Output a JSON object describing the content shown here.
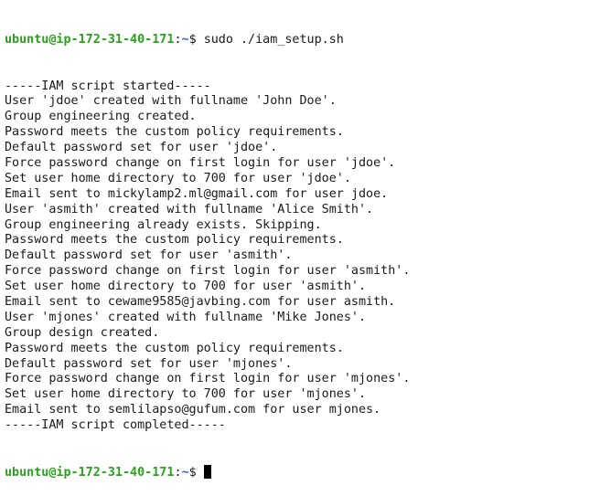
{
  "prompt": {
    "user_host": "ubuntu@ip-172-31-40-171",
    "separator": ":",
    "path": "~",
    "symbol": "$ "
  },
  "command": "sudo ./iam_setup.sh",
  "output_lines": [
    "-----IAM script started-----",
    "User 'jdoe' created with fullname 'John Doe'.",
    "Group engineering created.",
    "Password meets the custom policy requirements.",
    "Default password set for user 'jdoe'.",
    "Force password change on first login for user 'jdoe'.",
    "Set user home directory to 700 for user 'jdoe'.",
    "Email sent to mickylamp2.ml@gmail.com for user jdoe.",
    "User 'asmith' created with fullname 'Alice Smith'.",
    "Group engineering already exists. Skipping.",
    "Password meets the custom policy requirements.",
    "Default password set for user 'asmith'.",
    "Force password change on first login for user 'asmith'.",
    "Set user home directory to 700 for user 'asmith'.",
    "Email sent to cewame9585@javbing.com for user asmith.",
    "User 'mjones' created with fullname 'Mike Jones'.",
    "Group design created.",
    "Password meets the custom policy requirements.",
    "Default password set for user 'mjones'.",
    "Force password change on first login for user 'mjones'.",
    "Set user home directory to 700 for user 'mjones'.",
    "Email sent to semlilapso@gufum.com for user mjones.",
    "-----IAM script completed-----"
  ],
  "colors": {
    "background": "#ffffff",
    "text": "#1a1a1a",
    "prompt_user": "#2aa21b",
    "prompt_path": "#3166c8",
    "cursor": "#000000"
  }
}
